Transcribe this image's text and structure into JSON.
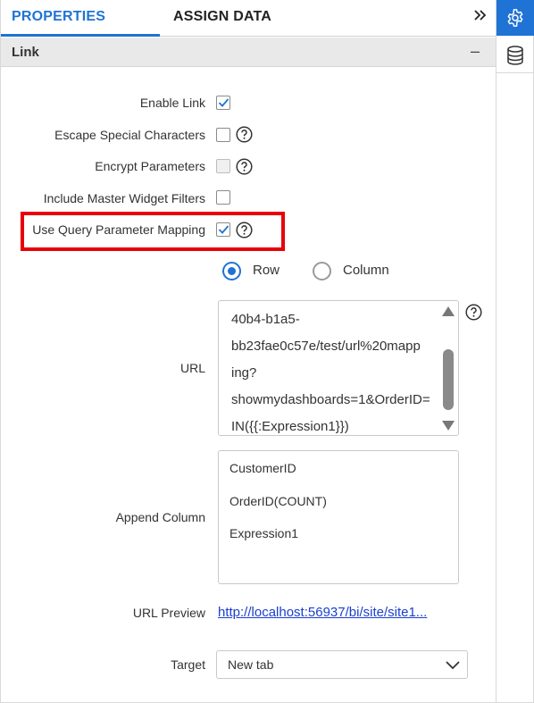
{
  "tabs": {
    "properties": "PROPERTIES",
    "assign_data": "ASSIGN DATA"
  },
  "section": {
    "title": "Link",
    "collapse_glyph": "–"
  },
  "fields": {
    "enable_link": {
      "label": "Enable Link",
      "checked": true
    },
    "escape_special": {
      "label": "Escape Special Characters",
      "checked": false
    },
    "encrypt_params": {
      "label": "Encrypt Parameters",
      "checked": false,
      "disabled": true
    },
    "include_master": {
      "label": "Include Master Widget Filters",
      "checked": false
    },
    "use_query_mapping": {
      "label": "Use Query Parameter Mapping",
      "checked": true
    }
  },
  "mapping_mode": {
    "row_label": "Row",
    "column_label": "Column",
    "selected": "Row"
  },
  "url": {
    "label": "URL",
    "value": "40b4-b1a5-bb23fae0c57e/test/url%20mapping?showmydashboards=1&OrderID=IN({{:Expression1}})"
  },
  "append_column": {
    "label": "Append Column",
    "items": [
      "CustomerID",
      "OrderID(COUNT)",
      "Expression1"
    ]
  },
  "url_preview": {
    "label": "URL Preview",
    "value": "http://localhost:56937/bi/site/site1..."
  },
  "target": {
    "label": "Target",
    "value": "New tab"
  },
  "icons": {
    "settings": "gear-icon",
    "data": "database-icon",
    "help": "question-circle-icon",
    "collapse": "double-chevron-right-icon"
  },
  "colors": {
    "accent": "#1f73d4",
    "highlight": "#e8000b",
    "link": "#1a3fcf"
  }
}
